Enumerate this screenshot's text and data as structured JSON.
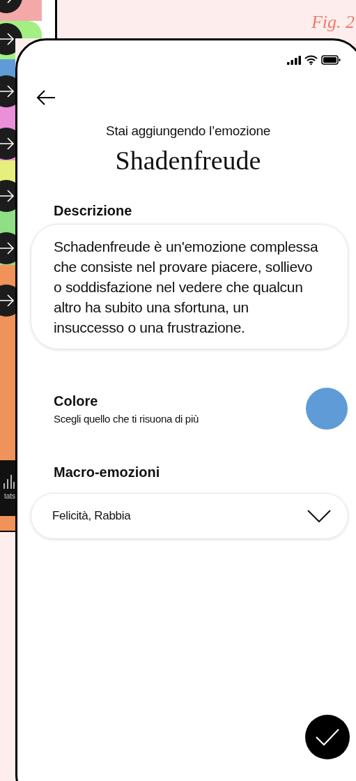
{
  "figure_label": "Fig. 2",
  "background_phone": {
    "nav_label": "tats"
  },
  "phone": {
    "subtitle": "Stai aggiungendo l’emozione",
    "title": "Shadenfreude",
    "description": {
      "label": "Descrizione",
      "value": "Schadenfreude è un'emozione complessa che consiste nel provare piacere, sollievo o soddisfazione nel vedere che qualcun altro ha subito una sfortuna, un insuccesso o una frustrazione."
    },
    "color": {
      "label": "Colore",
      "hint": "Scegli quello che ti risuona di più",
      "color": "#5f9bd6"
    },
    "macro": {
      "label": "Macro-emozioni",
      "value": "Felicità, Rabbia"
    }
  }
}
